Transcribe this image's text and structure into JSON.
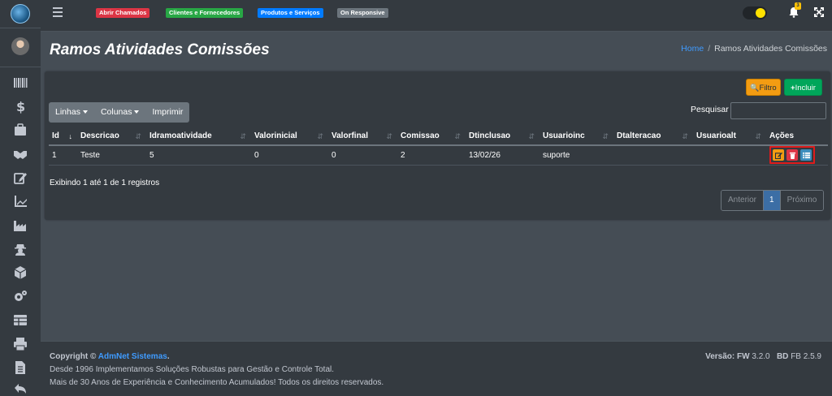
{
  "topbar": {
    "badges": [
      {
        "label": "Abrir Chamados",
        "color": "#dc3545"
      },
      {
        "label": "Clientes e Fornecedores",
        "color": "#28a745"
      },
      {
        "label": "Produtos e Serviços",
        "color": "#007bff"
      },
      {
        "label": "On Responsive",
        "color": "#6c757d"
      }
    ],
    "notification_count": "3"
  },
  "sidebar": {
    "icons": [
      "barcode-icon",
      "dollar-icon",
      "briefcase-icon",
      "handshake-icon",
      "edit-icon",
      "chart-line-icon",
      "industry-icon",
      "user-secret-icon",
      "cube-icon",
      "cogs-icon",
      "table-icon",
      "print-icon",
      "file-icon",
      "undo-icon"
    ]
  },
  "page": {
    "title": "Ramos Atividades Comissões",
    "breadcrumb_home": "Home",
    "breadcrumb_sep": "/",
    "breadcrumb_current": "Ramos Atividades Comissões"
  },
  "toolbar": {
    "filtro_label": "Filtro",
    "incluir_label": "Incluir",
    "linhas_label": "Linhas",
    "colunas_label": "Colunas",
    "imprimir_label": "Imprimir",
    "search_label": "Pesquisar",
    "search_value": ""
  },
  "table": {
    "headers": [
      "Id",
      "Descricao",
      "Idramoatividade",
      "Valorinicial",
      "Valorfinal",
      "Comissao",
      "Dtinclusao",
      "Usuarioinc",
      "Dtalteracao",
      "Usuarioalt",
      "Ações"
    ],
    "rows": [
      [
        "1",
        "Teste",
        "5",
        "0",
        "0",
        "2",
        "13/02/26",
        "suporte",
        "",
        ""
      ]
    ]
  },
  "info": "Exibindo 1 até 1 de 1 registros",
  "pager": {
    "prev": "Anterior",
    "page": "1",
    "next": "Próximo"
  },
  "footer": {
    "copyright_prefix": "Copyright ©",
    "brand": "AdmNet Sistemas",
    "copyright_suffix": ".",
    "line2": "Desde 1996 Implementamos Soluções Robustas para Gestão e Controle Total.",
    "line3": "Mais de 30 Anos de Experiência e Conhecimento Acumulados! Todos os direitos reservados.",
    "versao_label": "Versão: FW",
    "versao_value": "3.2.0",
    "bd_label": "BD",
    "bd_value": "FB 2.5.9"
  }
}
